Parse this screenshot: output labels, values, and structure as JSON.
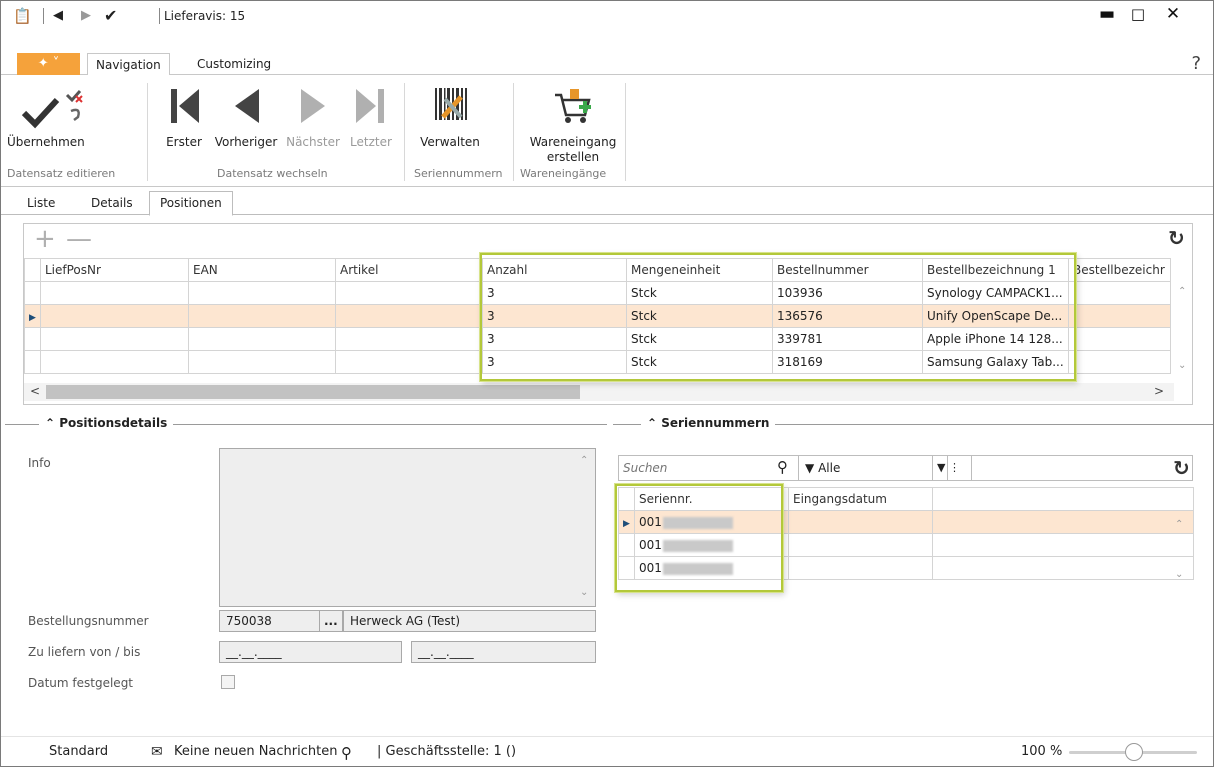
{
  "window": {
    "title": "Lieferavis: 15"
  },
  "ribbon_tabs": {
    "file_icon": "orange-menu-icon",
    "navigation": "Navigation",
    "customizing": "Customizing",
    "help": "?"
  },
  "ribbon": {
    "uebernehmen": "Übernehmen",
    "erster": "Erster",
    "vorheriger": "Vorheriger",
    "naechster": "Nächster",
    "letzter": "Letzter",
    "verwalten": "Verwalten",
    "wareneingang": "Wareneingang erstellen",
    "groups": {
      "datensatz_editieren": "Datensatz editieren",
      "datensatz_wechseln": "Datensatz wechseln",
      "seriennummern": "Seriennummern",
      "wareneingaenge": "Wareneingänge"
    }
  },
  "page_tabs": {
    "liste": "Liste",
    "details": "Details",
    "positionen": "Positionen"
  },
  "positions_grid": {
    "columns": [
      "LiefPosNr",
      "EAN",
      "Artikel",
      "Anzahl",
      "Mengeneinheit",
      "Bestellnummer",
      "Bestellbezeichnung 1",
      "Bestellbezeichr"
    ],
    "rows": [
      {
        "liefposnr": "",
        "ean": "",
        "artikel": "",
        "anzahl": "3",
        "einheit": "Stck",
        "bestellnummer": "103936",
        "bez1": "Synology CAMPACK1...",
        "bez2": ""
      },
      {
        "liefposnr": "",
        "ean": "",
        "artikel": "",
        "anzahl": "3",
        "einheit": "Stck",
        "bestellnummer": "136576",
        "bez1": "Unify OpenScape De...",
        "bez2": ""
      },
      {
        "liefposnr": "",
        "ean": "",
        "artikel": "",
        "anzahl": "3",
        "einheit": "Stck",
        "bestellnummer": "339781",
        "bez1": "Apple iPhone 14 128...",
        "bez2": ""
      },
      {
        "liefposnr": "",
        "ean": "",
        "artikel": "",
        "anzahl": "3",
        "einheit": "Stck",
        "bestellnummer": "318169",
        "bez1": "Samsung Galaxy Tab...",
        "bez2": ""
      }
    ],
    "selected_row": 1
  },
  "positionsdetails": {
    "title": "Positionsdetails",
    "info_label": "Info",
    "bestellungsnummer_label": "Bestellungsnummer",
    "bestellungsnummer_value": "750038",
    "ellipsis": "...",
    "lieferant": "Herweck AG (Test)",
    "zu_liefern_label": "Zu liefern von / bis",
    "date_from": "__.__.____",
    "date_to": "__.__.____",
    "datum_festgelegt_label": "Datum festgelegt"
  },
  "seriennummern": {
    "title": "Seriennummern",
    "search_placeholder": "Suchen",
    "filter_label": "Alle",
    "columns": [
      "Seriennr.",
      "Eingangsdatum"
    ],
    "rows": [
      {
        "seriennr": "001",
        "eingangsdatum": ""
      },
      {
        "seriennr": "001",
        "eingangsdatum": ""
      },
      {
        "seriennr": "001",
        "eingangsdatum": ""
      }
    ]
  },
  "statusbar": {
    "profile": "Standard",
    "messages": "Keine neuen Nachrichten",
    "branch": "| Geschäftsstelle:  1 ()",
    "zoom": "100 %"
  },
  "colors": {
    "accent_orange": "#f5a23b",
    "selection": "#fde6d1",
    "highlight_border": "#b3c83a"
  }
}
